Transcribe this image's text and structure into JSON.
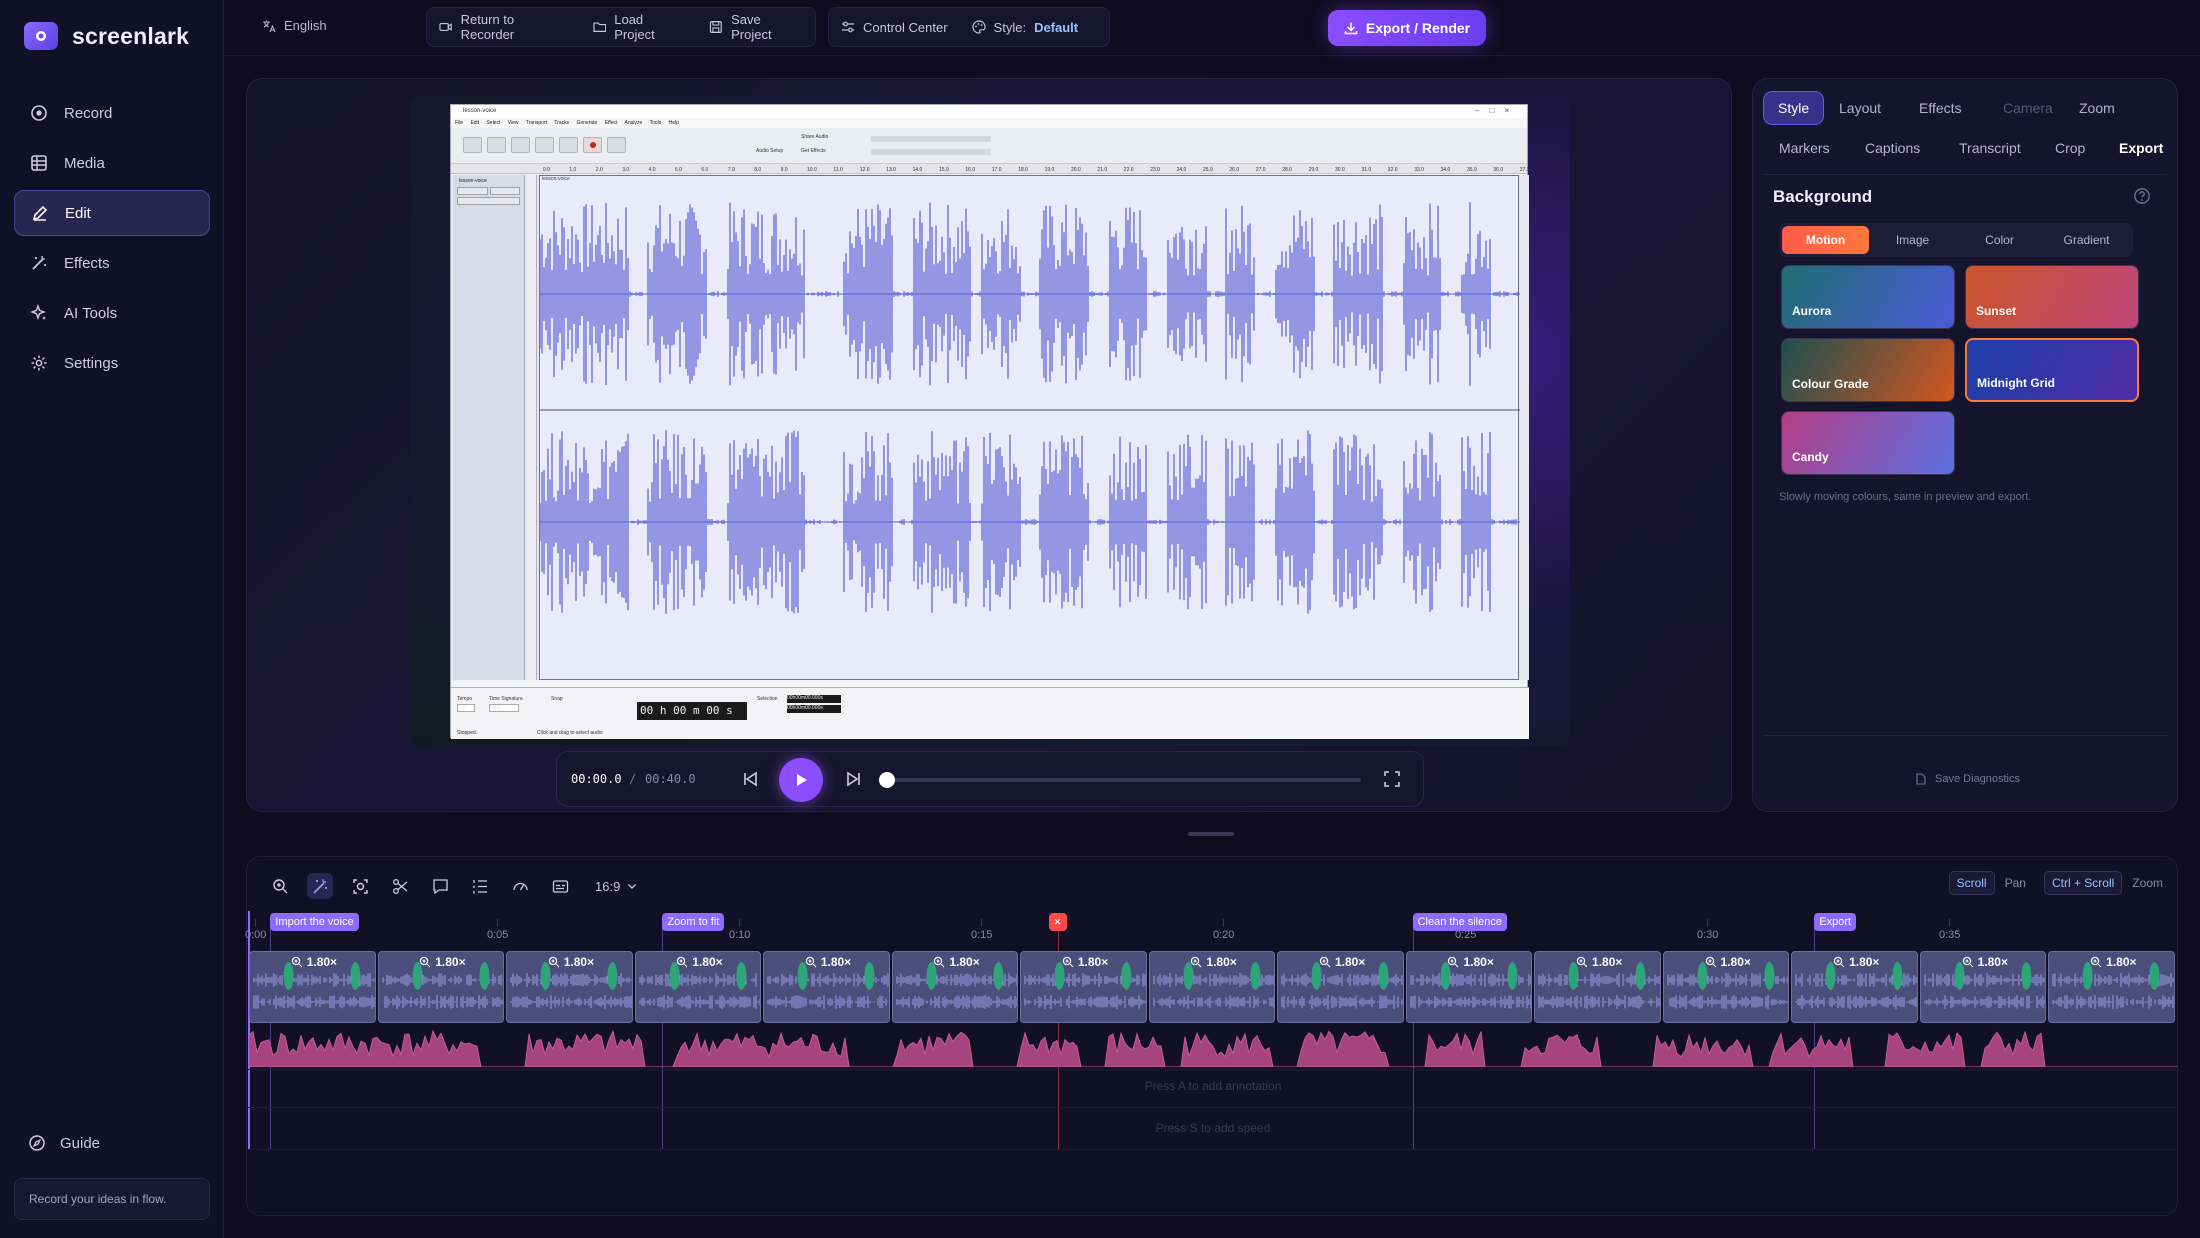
{
  "app": {
    "name": "screenlark"
  },
  "sidebar": {
    "items": [
      {
        "label": "Record",
        "icon": "record-icon"
      },
      {
        "label": "Media",
        "icon": "media-icon"
      },
      {
        "label": "Edit",
        "icon": "pen-icon",
        "active": true
      },
      {
        "label": "Effects",
        "icon": "wand-icon"
      },
      {
        "label": "AI Tools",
        "icon": "sparkle-icon"
      },
      {
        "label": "Settings",
        "icon": "gear-icon"
      }
    ],
    "guide": "Guide",
    "tip": "Record your ideas in flow."
  },
  "topbar": {
    "language": "English",
    "return_label": "Return to Recorder",
    "load_label": "Load Project",
    "save_label": "Save Project",
    "control_center_label": "Control Center",
    "style_label": "Style:",
    "style_value": "Default",
    "export_label": "Export / Render"
  },
  "preview": {
    "app_title": "lesson-voice",
    "menu": "File Edit Select View Transport Tracks Generate Effect Analyze Tools Help",
    "track_name": "lesson-voice",
    "track_mute": "Mute",
    "track_solo": "Solo",
    "track_effects": "Effects",
    "clip_label": "lesson-voice",
    "time_display": "00 h 00 m 00 s",
    "status_left": "Stopped.",
    "status_right": "Click and drag to select audio",
    "bottom_tempo": "Tempo",
    "bottom_sig": "Time Signature",
    "bottom_snap": "Snap",
    "bottom_selection": "Selection",
    "tempo_value": "120",
    "sig_value": "4 / 4",
    "sel_start": "00h00m00.000s",
    "sel_end": "00h00m00.000s",
    "tools_share": "Share Audio",
    "tools_setup": "Audio Setup",
    "tools_effects": "Get Effects",
    "ruler": [
      "0.0",
      "1.0",
      "2.0",
      "3.0",
      "4.0",
      "5.0",
      "6.0",
      "7.0",
      "8.0",
      "9.0",
      "10.0",
      "11.0",
      "12.0",
      "13.0",
      "14.0",
      "15.0",
      "16.0",
      "17.0",
      "18.0",
      "19.0",
      "20.0",
      "21.0",
      "22.0",
      "23.0",
      "24.0",
      "25.0",
      "26.0",
      "27.0",
      "28.0",
      "29.0",
      "30.0",
      "31.0",
      "32.0",
      "33.0",
      "34.0",
      "35.0",
      "36.0",
      "37.0"
    ]
  },
  "playback": {
    "current": "00:00.0",
    "separator": "/",
    "total": "00:40.0",
    "progress": 0
  },
  "panel": {
    "tabs_row1": [
      {
        "label": "Style",
        "state": "active"
      },
      {
        "label": "Layout",
        "state": "normal"
      },
      {
        "label": "Effects",
        "state": "normal"
      },
      {
        "label": "Camera",
        "state": "disabled"
      },
      {
        "label": "Zoom",
        "state": "normal"
      }
    ],
    "tabs_row2": [
      {
        "label": "Markers",
        "state": "normal"
      },
      {
        "label": "Captions",
        "state": "normal"
      },
      {
        "label": "Transcript",
        "state": "normal"
      },
      {
        "label": "Crop",
        "state": "normal"
      },
      {
        "label": "Export",
        "state": "bold"
      }
    ],
    "background_title": "Background",
    "segments": [
      "Motion",
      "Image",
      "Color",
      "Gradient"
    ],
    "active_segment": "Motion",
    "swatches": [
      {
        "label": "Aurora",
        "colors": [
          "#1f6d72",
          "#4b5ad6"
        ]
      },
      {
        "label": "Sunset",
        "colors": [
          "#c9562a",
          "#c2447a"
        ]
      },
      {
        "label": "Colour Grade",
        "colors": [
          "#1d4f4f",
          "#d4561f"
        ]
      },
      {
        "label": "Midnight Grid",
        "colors": [
          "#1c3fa8",
          "#4e2aa6"
        ],
        "selected": true
      },
      {
        "label": "Candy",
        "colors": [
          "#b43e86",
          "#5b6fe0"
        ]
      }
    ],
    "hint": "Slowly moving colours, same in preview and export.",
    "diagnostics": "Save Diagnostics"
  },
  "timeline": {
    "aspect": "16:9",
    "scroll_key": "Scroll",
    "scroll_action": "Pan",
    "zoom_key": "Ctrl + Scroll",
    "zoom_action": "Zoom",
    "ticks": [
      "0:00",
      "0:05",
      "0:10",
      "0:15",
      "0:20",
      "0:25",
      "0:30",
      "0:35"
    ],
    "markers": [
      {
        "label": "Import the voice",
        "time": 0.4
      },
      {
        "label": "Zoom to fit",
        "time": 8.5
      },
      {
        "label": "Clean the silence",
        "time": 24.0
      },
      {
        "label": "Export",
        "time": 32.3
      }
    ],
    "cut_marker_time": 16.5,
    "zoom_factor": "1.80×",
    "clip_count": 15,
    "annotation_hint": "Press A to add annotation",
    "speed_hint": "Press S to add speed"
  },
  "colors": {
    "accent": "#8a4dff",
    "selected": "#ff7a3a",
    "marker": "#8d6bff",
    "waveform": "#5b5fd6"
  }
}
